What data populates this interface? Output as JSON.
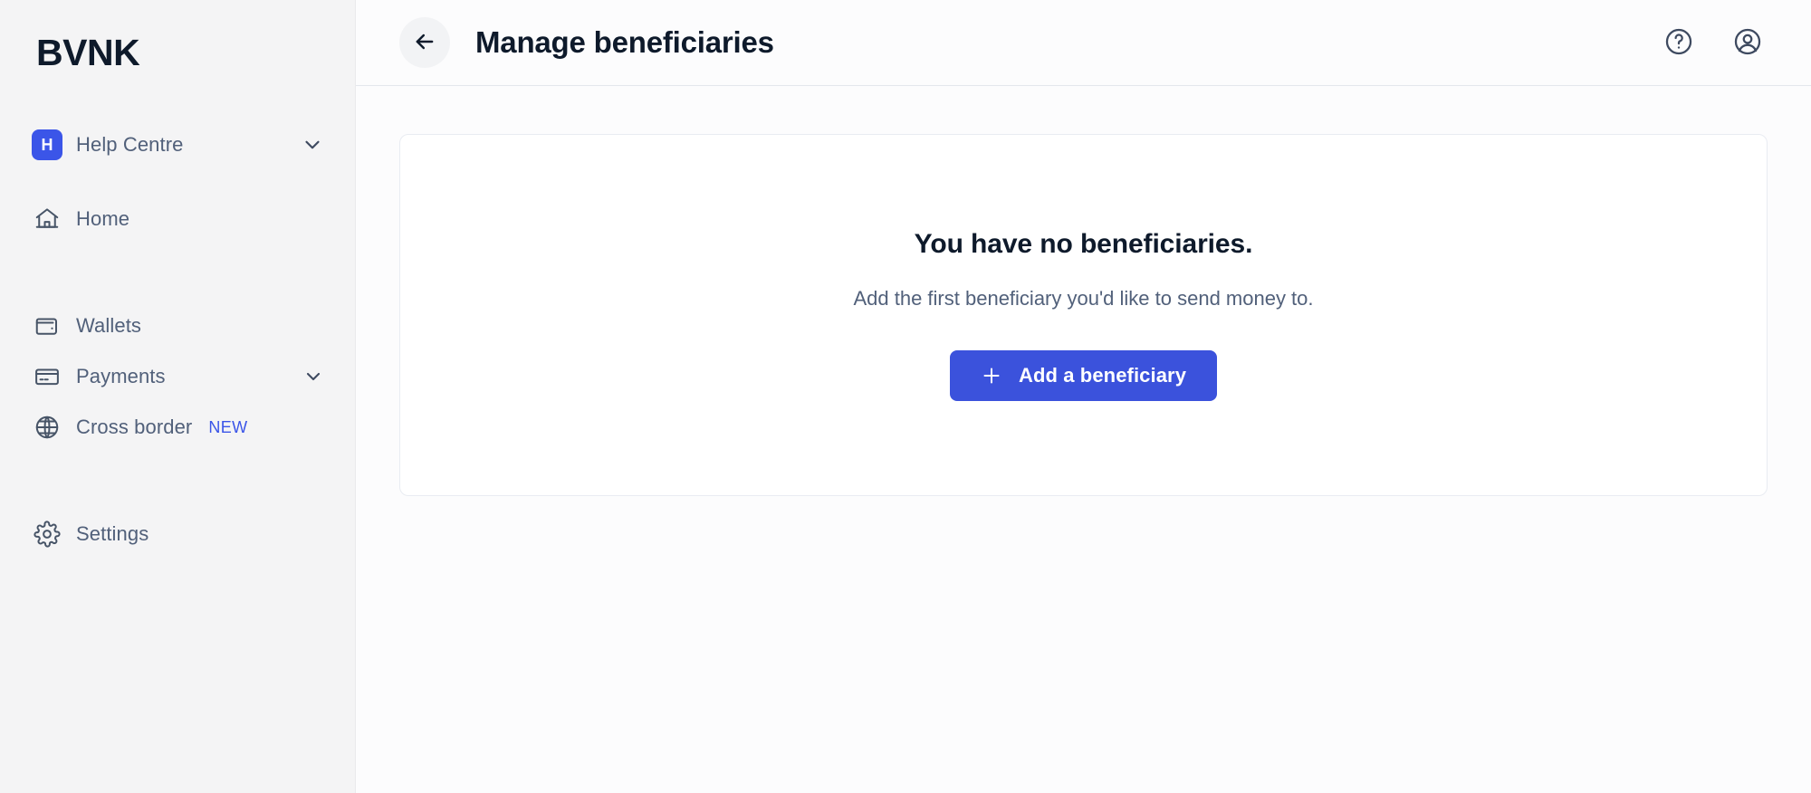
{
  "brand": {
    "name": "BVNK"
  },
  "sidebar": {
    "help_centre": {
      "badge_letter": "H",
      "label": "Help Centre"
    },
    "items": [
      {
        "label": "Home",
        "icon": "home-icon",
        "badge": "",
        "chevron": false
      },
      {
        "label": "Wallets",
        "icon": "wallet-icon",
        "badge": "",
        "chevron": false
      },
      {
        "label": "Payments",
        "icon": "credit-card-icon",
        "badge": "",
        "chevron": true
      },
      {
        "label": "Cross border",
        "icon": "globe-icon",
        "badge": "NEW",
        "chevron": false
      },
      {
        "label": "Settings",
        "icon": "gear-icon",
        "badge": "",
        "chevron": false
      }
    ]
  },
  "header": {
    "title": "Manage beneficiaries",
    "back_icon": "arrow-left-icon",
    "help_icon": "question-circle-icon",
    "account_icon": "user-circle-icon"
  },
  "main": {
    "empty_state": {
      "title": "You have no beneficiaries.",
      "subtitle": "Add the first beneficiary you'd like to send money to.",
      "cta_label": "Add a beneficiary",
      "cta_icon": "plus-icon"
    }
  },
  "colors": {
    "accent": "#3B52DC",
    "badge_blue": "#3B55E8",
    "text_primary": "#0E1A2B",
    "text_secondary": "#51607A",
    "sidebar_bg": "#F4F4F5",
    "content_bg": "#FCFCFD"
  }
}
